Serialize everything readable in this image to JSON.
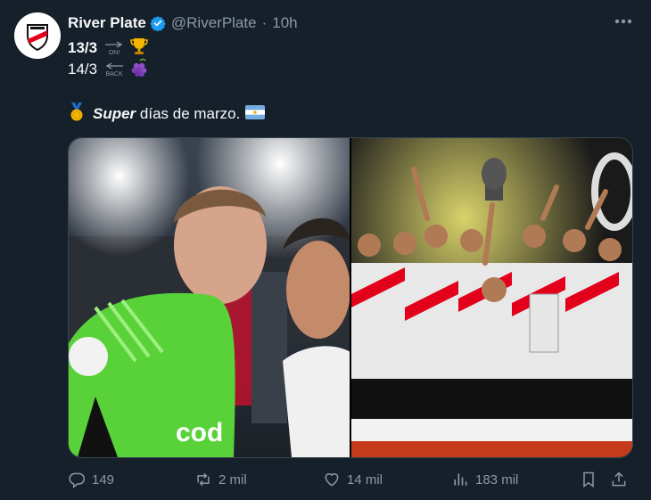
{
  "tweet": {
    "author_name": "River Plate",
    "handle": "@RiverPlate",
    "separator": "·",
    "time": "10h",
    "line1_date": "13/3",
    "line1_arrow": "ON!",
    "line2_date": "14/3",
    "line2_arrow": "BACK",
    "line3_bold": "Super",
    "line3_rest": " días de marzo.",
    "icons": [
      "verified-badge-icon",
      "trophy-icon",
      "grapes-icon",
      "medal-icon",
      "argentina-flag-icon"
    ]
  },
  "actions": {
    "replies": "149",
    "retweets": "2 mil",
    "likes": "14 mil",
    "views": "183 mil"
  },
  "colors": {
    "background": "#15202b",
    "text": "#f7f9f9",
    "muted": "#8b98a5",
    "verified": "#1d9bf0",
    "river_red": "#e3001b"
  }
}
